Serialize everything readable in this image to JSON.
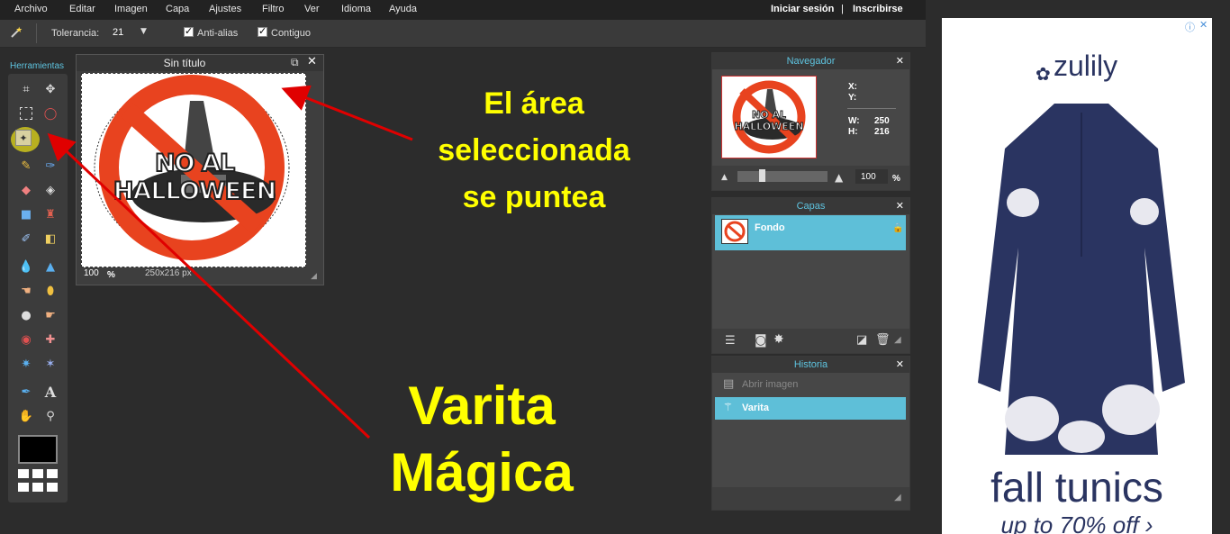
{
  "menubar": {
    "items": [
      "Archivo",
      "Editar",
      "Imagen",
      "Capa",
      "Ajustes",
      "Filtro",
      "Ver",
      "Idioma",
      "Ayuda"
    ],
    "login": "Iniciar sesión",
    "separator": "|",
    "signup": "Inscribirse"
  },
  "options": {
    "tolerance_label": "Tolerancia:",
    "tolerance_value": "21",
    "antialias_label": "Anti-alias",
    "contiguous_label": "Contiguo"
  },
  "tools": {
    "title": "Herramientas",
    "active_tool": "magic-wand"
  },
  "image_window": {
    "title": "Sin título",
    "zoom": "100",
    "zoom_unit": "%",
    "dimensions": "250x216 px",
    "image_text": "NO AL HALLOWEEN"
  },
  "navigator": {
    "title": "Navegador",
    "x_label": "X:",
    "y_label": "Y:",
    "w_label": "W:",
    "w_value": "250",
    "h_label": "H:",
    "h_value": "216",
    "zoom_value": "100",
    "zoom_unit": "%",
    "preview_text": "NO AL HALLOWEEN"
  },
  "layers": {
    "title": "Capas",
    "items": [
      {
        "name": "Fondo"
      }
    ]
  },
  "history": {
    "title": "Historia",
    "items": [
      {
        "label": "Abrir imagen"
      },
      {
        "label": "Varita"
      }
    ]
  },
  "annotations": {
    "selection_line1": "El área",
    "selection_line2": "seleccionada",
    "selection_line3": "se puntea",
    "wand_line1": "Varita",
    "wand_line2": "Mágica"
  },
  "ad": {
    "brand": "zulily",
    "headline": "fall tunics",
    "subline": "up to 70% off ›"
  },
  "colors": {
    "background": "#2c2c2c",
    "panel_accent": "#5ec4e0",
    "annotation": "#ffff00",
    "arrow": "#e00000",
    "ad_navy": "#2a3461"
  }
}
